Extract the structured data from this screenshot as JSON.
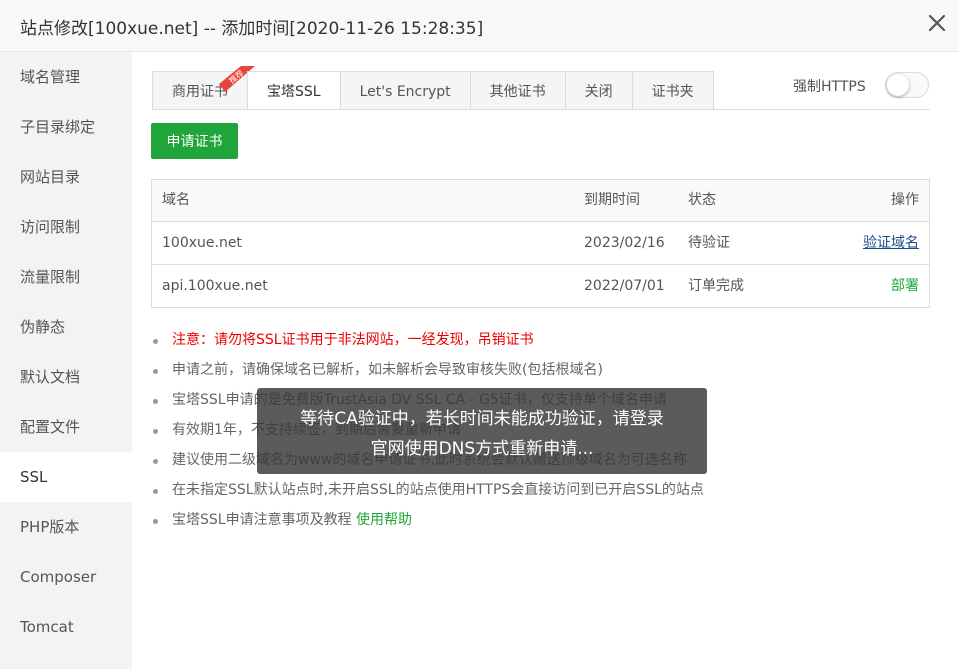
{
  "window": {
    "title": "站点修改[100xue.net] -- 添加时间[2020-11-26 15:28:35]",
    "close_icon": "close-icon"
  },
  "sidebar": {
    "items": [
      {
        "label": "域名管理",
        "active": false
      },
      {
        "label": "子目录绑定",
        "active": false
      },
      {
        "label": "网站目录",
        "active": false
      },
      {
        "label": "访问限制",
        "active": false
      },
      {
        "label": "流量限制",
        "active": false
      },
      {
        "label": "伪静态",
        "active": false
      },
      {
        "label": "默认文档",
        "active": false
      },
      {
        "label": "配置文件",
        "active": false
      },
      {
        "label": "SSL",
        "active": true
      },
      {
        "label": "PHP版本",
        "active": false
      },
      {
        "label": "Composer",
        "active": false
      },
      {
        "label": "Tomcat",
        "active": false
      }
    ]
  },
  "tabs": {
    "items": [
      {
        "label": "商用证书",
        "active": false
      },
      {
        "label": "宝塔SSL",
        "active": true
      },
      {
        "label": "Let's Encrypt",
        "active": false
      },
      {
        "label": "其他证书",
        "active": false
      },
      {
        "label": "关闭",
        "active": false
      },
      {
        "label": "证书夹",
        "active": false
      }
    ],
    "badge": "推荐",
    "badge_color": "#e8453c"
  },
  "force_https": {
    "label": "强制HTTPS",
    "enabled": false
  },
  "apply_button": "申请证书",
  "table": {
    "headers": [
      "域名",
      "到期时间",
      "状态",
      "操作"
    ],
    "rows": [
      {
        "domain": "100xue.net",
        "expire": "2023/02/16",
        "status": "待验证",
        "action": "验证域名"
      },
      {
        "domain": "api.100xue.net",
        "expire": "2022/07/01",
        "status": "订单完成",
        "action": "部署"
      }
    ]
  },
  "notes": [
    "注意：请勿将SSL证书用于非法网站，一经发现，吊销证书",
    "申请之前，请确保域名已解析，如未解析会导致审核失败(包括根域名)",
    "宝塔SSL申请的是免费版TrustAsia DV SSL CA - G5证书，仅支持单个域名申请",
    "有效期1年，不支持续签，到期后需要重新申请",
    "建议使用二级域名为www的域名申请证书,此时系统会默认赠送顶级域名为可选名称",
    "在未指定SSL默认站点时,未开启SSL的站点使用HTTPS会直接访问到已开启SSL的站点"
  ],
  "tutorial": {
    "text": "宝塔SSL申请注意事项及教程",
    "link": "使用帮助"
  },
  "toast": {
    "line1": "等待CA验证中，若长时间未能成功验证，请登录",
    "line2": "官网使用DNS方式重新申请..."
  },
  "colors": {
    "accent": "#20a53a",
    "warning": "#ee0000",
    "link": "#1a4c88"
  }
}
